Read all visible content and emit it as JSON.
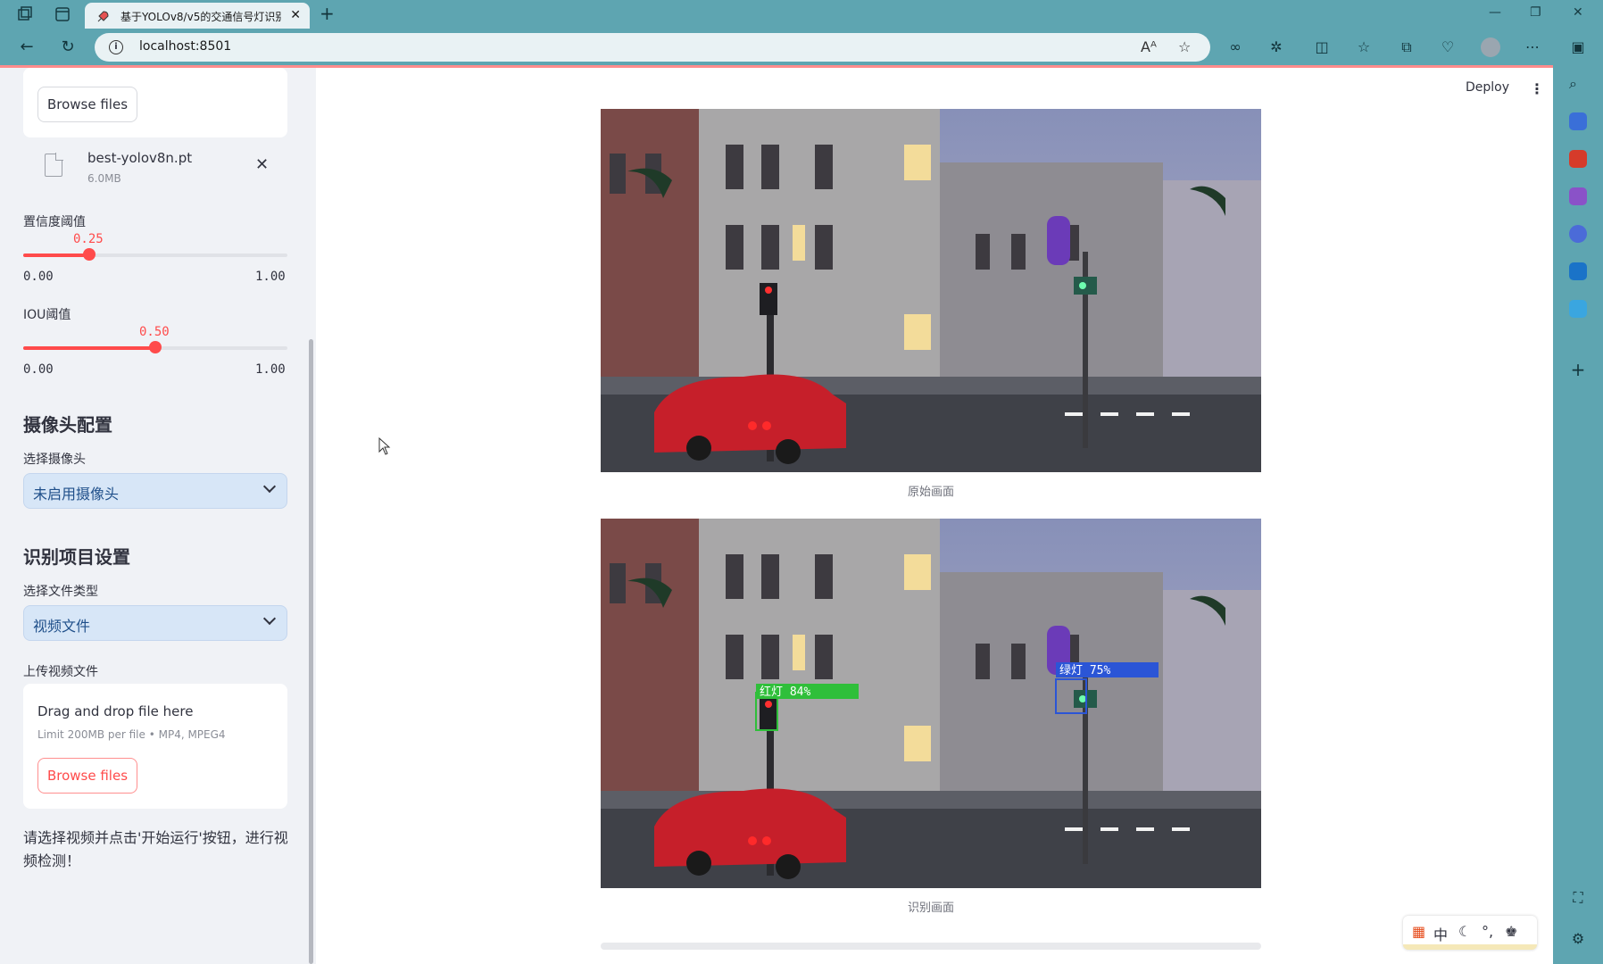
{
  "browser": {
    "tab_title": "基于YOLOv8/v5的交通信号灯识别",
    "url": "localhost:8501"
  },
  "app": {
    "deploy_label": "Deploy"
  },
  "sidebar": {
    "model_upload": {
      "browse_label": "Browse files",
      "file_name": "best-yolov8n.pt",
      "file_size": "6.0MB"
    },
    "confidence": {
      "label": "置信度阈值",
      "value": 0.25,
      "value_text": "0.25",
      "min_text": "0.00",
      "max_text": "1.00"
    },
    "iou": {
      "label": "IOU阈值",
      "value": 0.5,
      "value_text": "0.50",
      "min_text": "0.00",
      "max_text": "1.00"
    },
    "camera_section": {
      "title": "摄像头配置",
      "select_label": "选择摄像头",
      "selected": "未启用摄像头"
    },
    "detect_section": {
      "title": "识别项目设置",
      "select_label": "选择文件类型",
      "selected": "视频文件",
      "upload_label": "上传视频文件",
      "drop_text": "Drag and drop file here",
      "limit_text": "Limit 200MB per file • MP4, MPEG4",
      "browse_label": "Browse files"
    },
    "hint": "请选择视频并点击'开始运行'按钮，进行视频检测！"
  },
  "main": {
    "original_caption": "原始画面",
    "detected_caption": "识别画面",
    "detections": [
      {
        "label": "红灯 84%",
        "color": "#2fbf3a"
      },
      {
        "label": "绿灯 75%",
        "color": "#2b55d6"
      }
    ]
  },
  "ime": {
    "mode": "中"
  },
  "colors": {
    "accent": "#ff4b4b",
    "chrome": "#5ea5b1",
    "sidebar_bg": "#f0f2f6",
    "select_bg": "#d7e6f7"
  }
}
